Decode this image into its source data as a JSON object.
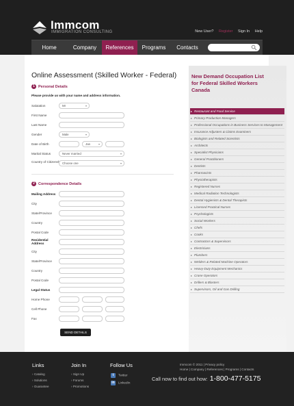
{
  "header": {
    "logo_name": "Immcom",
    "logo_sub": "IMMIGRATION CONSULTING",
    "toplinks": [
      "New User?",
      "Register",
      "Sign In",
      "Help"
    ],
    "nav": [
      "Home",
      "Company",
      "References",
      "Programs",
      "Contacts"
    ],
    "active_nav": "References",
    "search_placeholder": ""
  },
  "form": {
    "title": "Online Assessment (Skilled Worker - Federal)",
    "section1": {
      "num": "1",
      "title": "Personal Details"
    },
    "intro": "Please provide us with your name and address information.",
    "salutation": {
      "label": "Salutation",
      "value": "Mr"
    },
    "first_name": {
      "label": "First Name"
    },
    "last_name": {
      "label": "Last Name"
    },
    "gender": {
      "label": "Gender",
      "value": "Male"
    },
    "dob": {
      "label": "Date of Birth",
      "month": "Jan"
    },
    "marital": {
      "label": "Marital Status",
      "value": "Never married"
    },
    "citizenship": {
      "label": "Country of Citizenship",
      "value": "Choose one"
    },
    "section2": {
      "num": "2",
      "title": "Correspondence Details"
    },
    "mailing": "Mailing Address",
    "city": "City",
    "state": "State/Province",
    "country": "Country",
    "postal": "Postal Code",
    "residential": "Residential Address",
    "city2": "City",
    "state2": "State/Province",
    "country2": "Country",
    "postal2": "Postal Code",
    "legal_status": "Legal Status",
    "home_phone": "Home Phone",
    "cell_phone": "Cell Phone",
    "fax": "Fax",
    "send": "SEND DETAILS"
  },
  "sidebar": {
    "title": "New Demand Occupation List for Federal Skilled Workers Canada",
    "items": [
      "Restaurant and Food Service",
      "Primary Production Managers",
      "Professional Occupations in Business Services to Management",
      "Insurance Adjusters & Claims Examiners",
      "Biologists and Related Scientists",
      "Architects",
      "Specialist Physicians",
      "General Practitioners",
      "Dentists",
      "Pharmacists",
      "Physiotherapists",
      "Registered Nurses",
      "Medical Radiation Technologists",
      "Dental Hygienists & Dental Therapists",
      "Licensed Practical Nurses",
      "Psychologists",
      "Social Workers",
      "Chefs",
      "Cooks",
      "Contractors & Supervisors",
      "Electricians",
      "Plumbers",
      "Welders & Related Machine Operators",
      "Heavy-Duty Equipment Mechanics",
      "Crane Operators",
      "Drillers & Blasters",
      "Supervisors, Oil and Gas Drilling"
    ],
    "highlighted": 0
  },
  "footer": {
    "links_head": "Links",
    "links": [
      "Catalog",
      "Solutions",
      "Guarantee"
    ],
    "join_head": "Join In",
    "join": [
      "Sign Up",
      "Forums",
      "Promotions"
    ],
    "follow_head": "Follow Us",
    "follow": [
      "Twitter",
      "LinkedIn"
    ],
    "copyright": "Immcom © 2011 | Privacy policy",
    "footer_nav": "Home | Company | References | Programs | Contacts",
    "call_text": "Call now to find out how:",
    "phone": "1-800-477-5175"
  },
  "colors": {
    "accent": "#8f2050",
    "header": "#1f1f1f"
  }
}
